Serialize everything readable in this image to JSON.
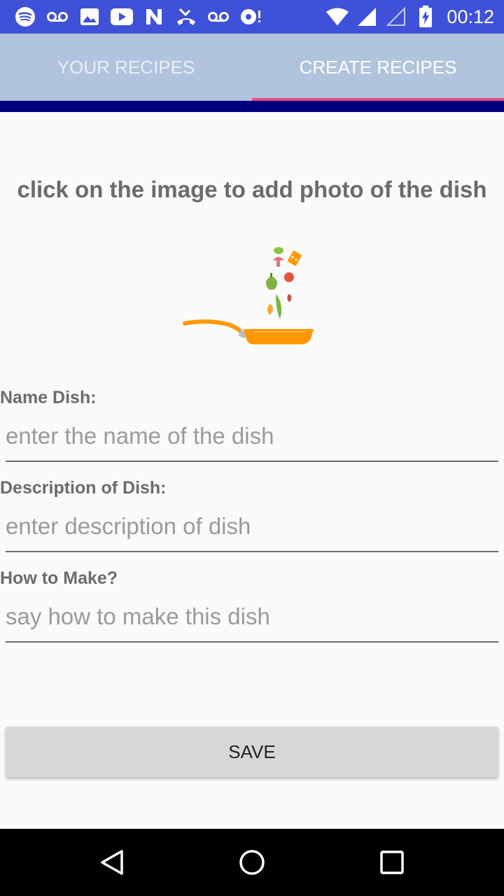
{
  "status_bar": {
    "left_icons": [
      "spotify-icon",
      "voicemail-icon",
      "image-icon",
      "youtube-icon",
      "n-app-icon",
      "missed-call-icon",
      "voicemail-icon",
      "chat-icon"
    ],
    "right_icons": [
      "wifi-icon",
      "signal-icon",
      "signal-empty-icon",
      "battery-charging-icon"
    ],
    "time": "00:12"
  },
  "tabs": [
    {
      "label": "YOUR RECIPES",
      "active": false
    },
    {
      "label": "CREATE RECIPES",
      "active": true
    }
  ],
  "colors": {
    "status_bar": "#3f51d8",
    "tab_bar": "#b0c4de",
    "tab_indicator": "#e84a7f",
    "under_bar": "#00007f",
    "pan": "#ff9800"
  },
  "form": {
    "hint": "click on the image to add photo of the dish",
    "name_label": "Name Dish:",
    "name_placeholder": "enter the name of the dish",
    "name_value": "",
    "description_label": "Description of Dish:",
    "description_placeholder": "enter description of dish",
    "description_value": "",
    "how_label": "How to Make?",
    "how_placeholder": "say how to make this dish",
    "how_value": "",
    "save_label": "SAVE"
  },
  "nav": {
    "back": "back-icon",
    "home": "home-icon",
    "recents": "recents-icon"
  }
}
